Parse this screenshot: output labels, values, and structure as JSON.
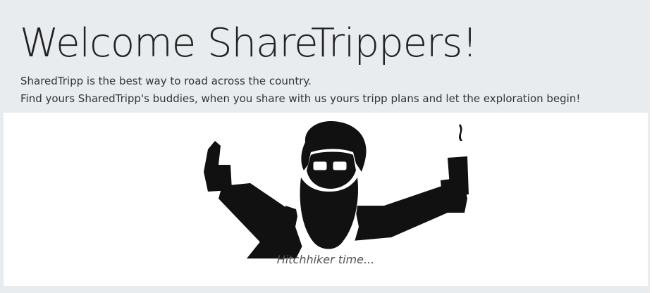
{
  "jumbotron": {
    "title": "Welcome ShareTrippers!",
    "lead_line_1": "SharedTripp is the best way to road across the country.",
    "lead_line_2": "Find yours SharedTripp's buddies, when you share with us yours tripp plans and let the exploration begin!"
  },
  "hero": {
    "image_icon": "hitchhiker-illustration-icon",
    "caption": "Hitchhiker time..."
  },
  "colors": {
    "jumbotron_bg": "#e9ecef",
    "card_bg": "#ffffff",
    "title_text": "#222222",
    "silhouette": "#111111"
  }
}
